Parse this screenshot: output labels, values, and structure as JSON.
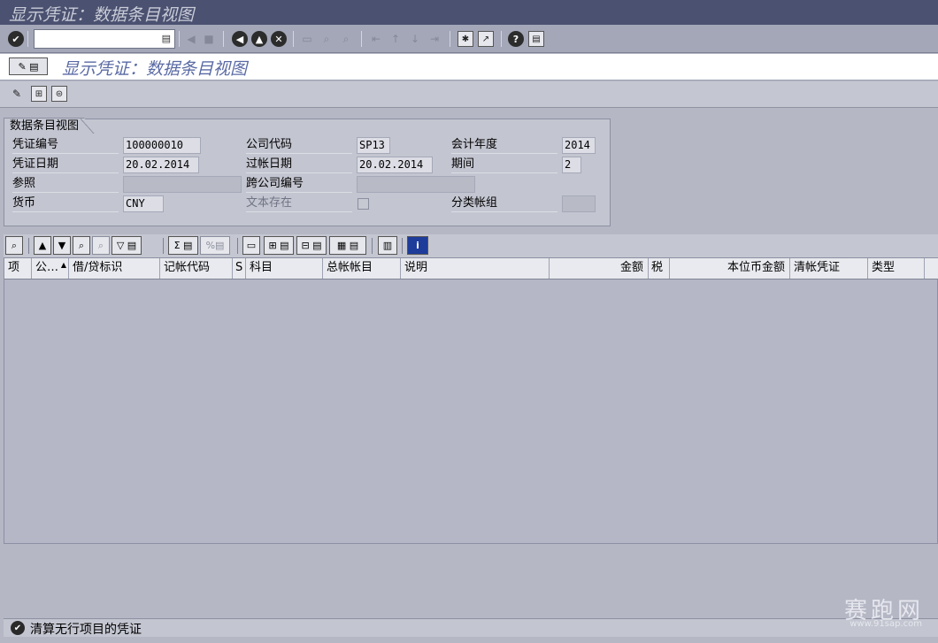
{
  "window": {
    "title": "显示凭证：数据条目视图"
  },
  "system_toolbar": {
    "command_field_value": "",
    "buttons": [
      "enter-icon",
      "back-icon",
      "save-icon",
      "green-back-icon",
      "exit-icon",
      "cancel-icon",
      "print-icon",
      "find-icon",
      "find-next-icon",
      "first-page-icon",
      "previous-page-icon",
      "next-page-icon",
      "last-page-icon",
      "new-session-icon",
      "shortcut-icon",
      "help-icon",
      "layout-menu-icon"
    ]
  },
  "app_title": {
    "text": "显示凭证：数据条目视图"
  },
  "header": {
    "tab_label": "数据条目视图",
    "fields": {
      "doc_number_label": "凭证编号",
      "doc_number": "100000010",
      "company_code_label": "公司代码",
      "company_code": "SP13",
      "fiscal_year_label": "会计年度",
      "fiscal_year": "2014",
      "doc_date_label": "凭证日期",
      "doc_date": "20.02.2014",
      "posting_date_label": "过帐日期",
      "posting_date": "20.02.2014",
      "period_label": "期间",
      "period": "2",
      "reference_label": "参照",
      "reference": "",
      "cross_company_label": "跨公司编号",
      "cross_company": "",
      "currency_label": "货币",
      "currency": "CNY",
      "text_exists_label": "文本存在",
      "text_exists": false,
      "ledger_group_label": "分类帐组",
      "ledger_group": ""
    }
  },
  "grid": {
    "columns": [
      "项",
      "公…",
      "借/贷标识",
      "记帐代码",
      "S",
      "科目",
      "总帐帐目",
      "说明",
      "金额",
      "税",
      "本位币金额",
      "清帐凭证",
      "类型"
    ],
    "rows": []
  },
  "status_bar": {
    "message": "清算无行项目的凭证"
  },
  "watermark": {
    "text": "赛跑网",
    "url": "www.91sap.com"
  }
}
